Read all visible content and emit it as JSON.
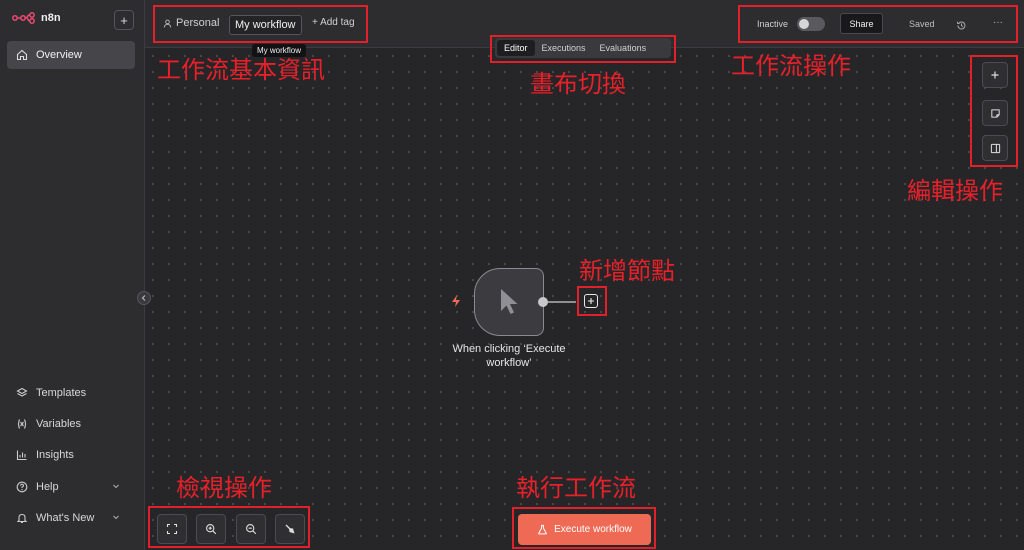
{
  "sidebar": {
    "brand": "n8n",
    "new_label": "+",
    "overview": "Overview",
    "bottom_items": [
      {
        "label": "Templates"
      },
      {
        "label": "Variables"
      },
      {
        "label": "Insights"
      },
      {
        "label": "Help"
      },
      {
        "label": "What's New"
      }
    ]
  },
  "header": {
    "project": "Personal",
    "workflow_name": "My workflow",
    "add_tag": "+ Add tag",
    "tooltip": "My workflow",
    "status": "Inactive",
    "active": false,
    "share": "Share",
    "saved": "Saved",
    "more": "···"
  },
  "tabs": [
    {
      "label": "Editor",
      "active": true
    },
    {
      "label": "Executions",
      "active": false
    },
    {
      "label": "Evaluations",
      "active": false
    }
  ],
  "canvas": {
    "node_label": "When clicking ‘Execute workflow’",
    "execute_button": "Execute workflow"
  },
  "annotations": {
    "workflow_info": "工作流基本資訊",
    "canvas_switch": "畫布切換",
    "workflow_actions": "工作流操作",
    "edit_actions": "編輯操作",
    "add_node": "新增節點",
    "view_actions": "檢視操作",
    "run_workflow": "執行工作流"
  },
  "colors": {
    "accent": "#ee6a55",
    "annotation": "#e0212a",
    "trigger": "#ee6a55"
  }
}
